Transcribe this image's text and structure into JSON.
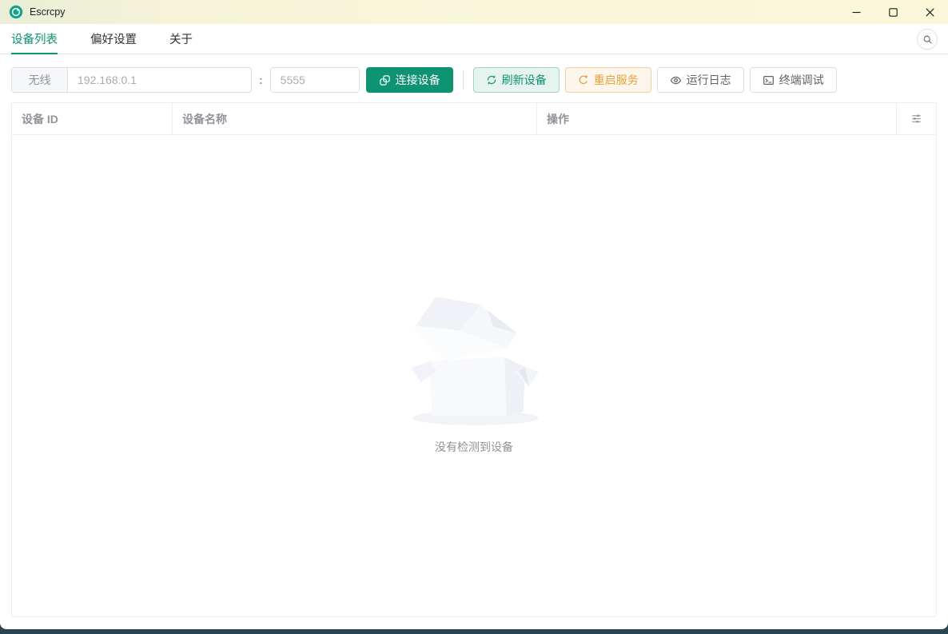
{
  "window": {
    "title": "Escrcpy"
  },
  "tabs": [
    {
      "label": "设备列表",
      "active": true
    },
    {
      "label": "偏好设置",
      "active": false
    },
    {
      "label": "关于",
      "active": false
    }
  ],
  "toolbar": {
    "wireless_label": "无线",
    "ip_placeholder": "192.168.0.1",
    "separator": ":",
    "port_placeholder": "5555",
    "connect_label": "连接设备",
    "refresh_label": "刷新设备",
    "restart_label": "重启服务",
    "logs_label": "运行日志",
    "terminal_label": "终端调试"
  },
  "table": {
    "columns": [
      "设备 ID",
      "设备名称",
      "操作"
    ],
    "rows": [],
    "empty_text": "没有检测到设备"
  },
  "icons": {
    "app": "escrcpy-logo",
    "search": "magnifier",
    "connect": "link",
    "refresh": "refresh-circular-arrows",
    "restart": "refresh-right",
    "logs": "eye",
    "terminal": "monitor-prompt",
    "header_settings": "sliders",
    "minimize": "line",
    "maximize": "square",
    "close": "cross"
  },
  "colors": {
    "accent": "#0e9373",
    "accent_bg": "#e7f3ee",
    "accent_border": "#a0d4c4",
    "warning": "#e6a23c",
    "warning_bg": "#fdf6ec",
    "warning_border": "#f3d19e",
    "titlebar_bg": "#f9f6da",
    "desktop_edge": "#2a4552"
  }
}
